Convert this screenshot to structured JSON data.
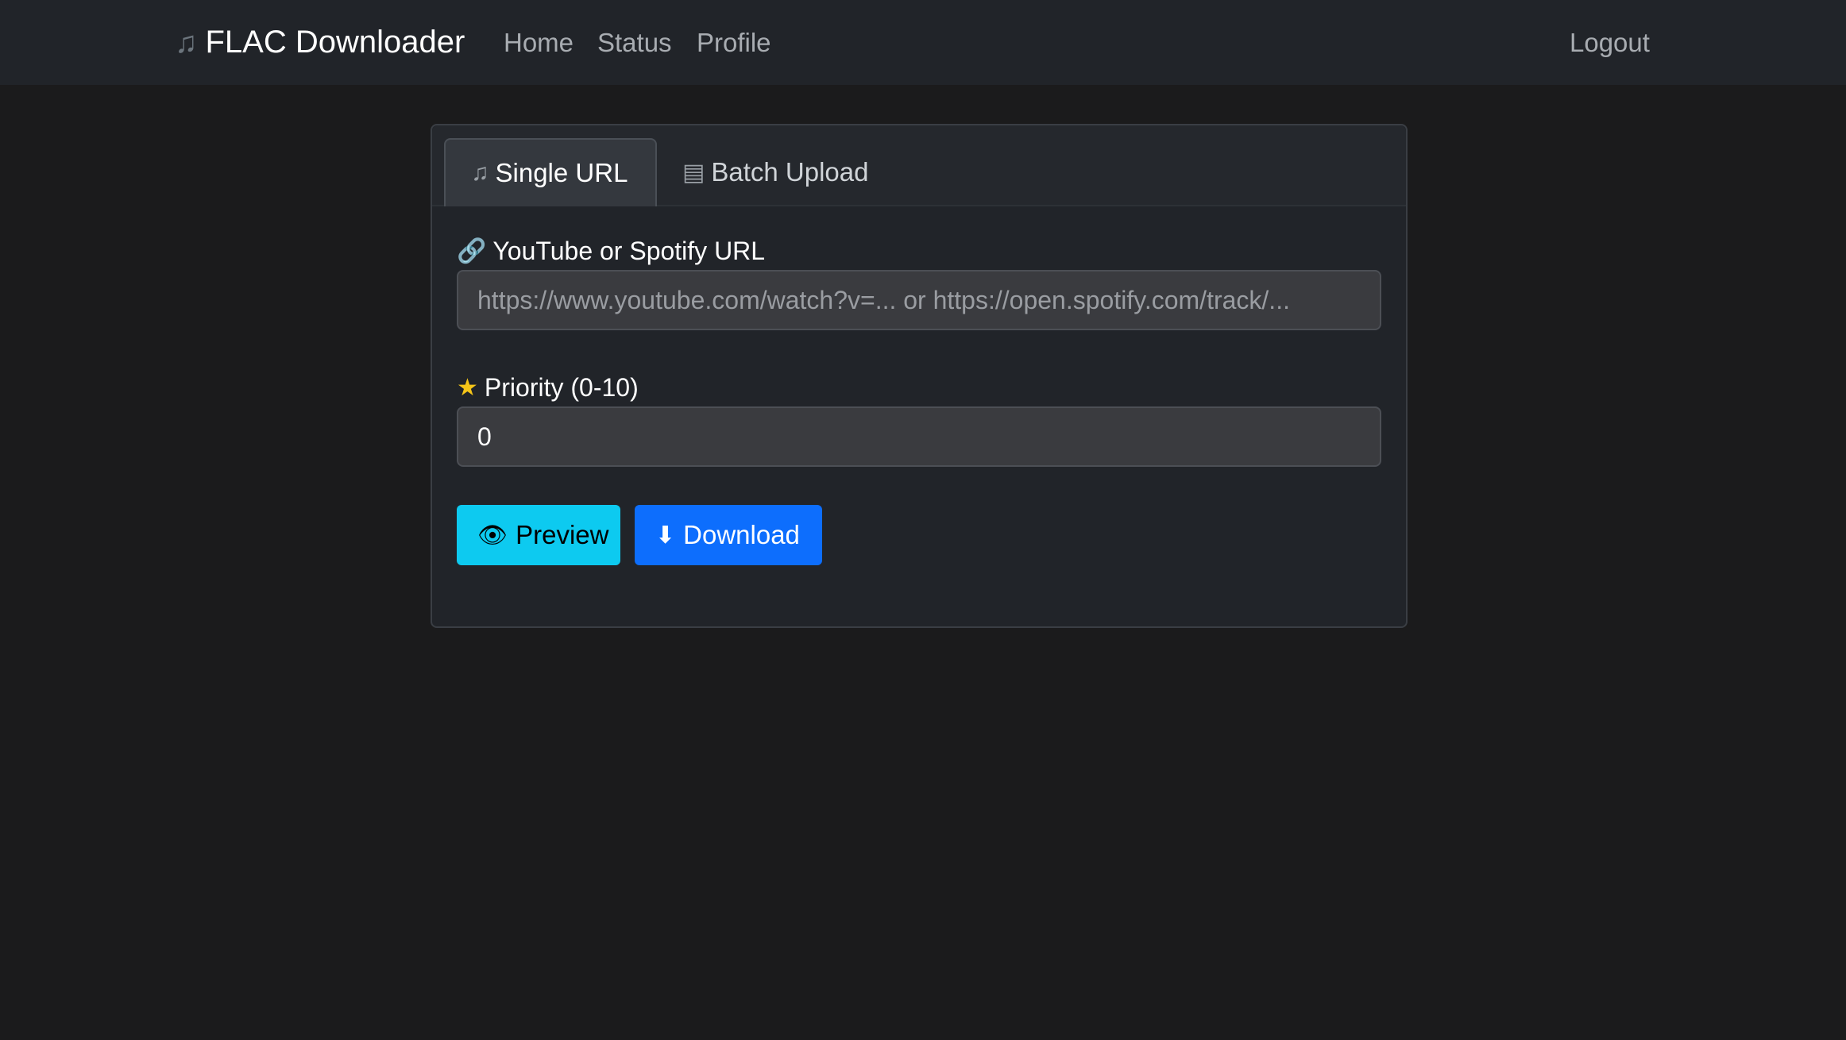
{
  "navbar": {
    "brand_icon": "music-note-icon",
    "brand_glyph": "♫",
    "brand": "FLAC Downloader",
    "links": [
      "Home",
      "Status",
      "Profile"
    ],
    "logout": "Logout"
  },
  "tabs": {
    "single": {
      "icon": "music-note-icon",
      "glyph": "♫",
      "label": "Single URL",
      "active": true
    },
    "batch": {
      "icon": "file-box-icon",
      "glyph": "▤",
      "label": "Batch Upload",
      "active": false
    }
  },
  "form": {
    "url_label_icon": "link-icon",
    "url_label_glyph": "🔗",
    "url_label": "YouTube or Spotify URL",
    "url_placeholder": "https://www.youtube.com/watch?v=... or https://open.spotify.com/track/...",
    "url_value": "",
    "priority_label_icon": "star-icon",
    "priority_label_glyph": "★",
    "priority_label": "Priority (0-10)",
    "priority_value": "0"
  },
  "buttons": {
    "preview_icon": "eye-icon",
    "preview_glyph": "👁",
    "preview": "Preview",
    "download_icon": "download-arrow-icon",
    "download_glyph": "⬇",
    "download": "Download"
  },
  "colors": {
    "background": "#1b1b1c",
    "navbar": "#212429",
    "preview_button": "#0dcaf0",
    "download_button": "#0d6efd",
    "star": "#f5c518"
  }
}
